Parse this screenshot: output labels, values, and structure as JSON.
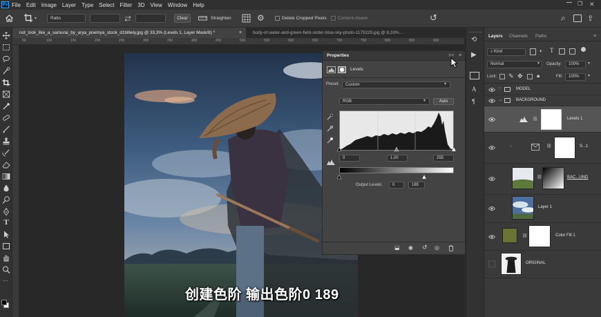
{
  "menu": [
    "File",
    "Edit",
    "Image",
    "Layer",
    "Type",
    "Select",
    "Filter",
    "3D",
    "View",
    "Window",
    "Help"
  ],
  "options_bar": {
    "ratio_value": "Ratio",
    "clear_label": "Clear",
    "straighten_label": "Straighten",
    "delete_cropped_label": "Delete Cropped Pixels",
    "content_aware_label": "Content-Aware"
  },
  "doc_tabs": [
    {
      "label": "not_look_like_a_samurai_by_arya_poemya_stock_d1bl6ely.jpg @ 33,3% (Levels 1, Layer Mask/8) *",
      "active": true
    },
    {
      "label": "body-of-water-and-green-field-under-blue-sky-photo-1179225.jpg @ 8,33%...",
      "active": false
    }
  ],
  "ruler_ticks": [
    "50",
    "100",
    "150",
    "200",
    "250",
    "300",
    "350",
    "400",
    "450",
    "500",
    "550",
    "600",
    "650",
    "700",
    "750",
    "800",
    "850",
    "900"
  ],
  "properties": {
    "title": "Properties",
    "collapse_glyph": ">>",
    "menu_glyph": "≡",
    "adjustment_name": "Levels",
    "preset_label": "Preset:",
    "preset_value": "Custom",
    "channel_value": "RGB",
    "auto_label": "Auto",
    "input_black": "0",
    "input_gamma": "1,00",
    "input_white": "255",
    "output_label": "Output Levels:",
    "output_black": "0",
    "output_white": "189"
  },
  "layers_panel": {
    "tabs": [
      "Layers",
      "Channels",
      "Paths"
    ],
    "kind_value": "Kind",
    "blend_mode": "Normal",
    "opacity_label": "Opacity:",
    "opacity_value": "100%",
    "lock_label": "Lock:",
    "fill_label": "Fill:",
    "fill_value": "100%",
    "layers": [
      {
        "name": "MODEL",
        "type": "group",
        "selected": false
      },
      {
        "name": "BACKGROUND",
        "type": "group",
        "selected": false
      },
      {
        "name": "Levels 1",
        "type": "adjustment",
        "selected": true
      },
      {
        "name": "S...1",
        "type": "smart",
        "selected": false
      },
      {
        "name": "BAC...UND",
        "type": "masked",
        "selected": false
      },
      {
        "name": "Layer 1",
        "type": "image",
        "selected": false
      },
      {
        "name": "Color Fill 1",
        "type": "fill",
        "selected": false
      },
      {
        "name": "ORIGINAL",
        "type": "image",
        "selected": false
      }
    ]
  },
  "subtitle": "创建色阶 输出色阶0 189",
  "colors": {
    "accent": "#31a8ff",
    "panel": "#434343",
    "selected_layer": "#555555"
  }
}
